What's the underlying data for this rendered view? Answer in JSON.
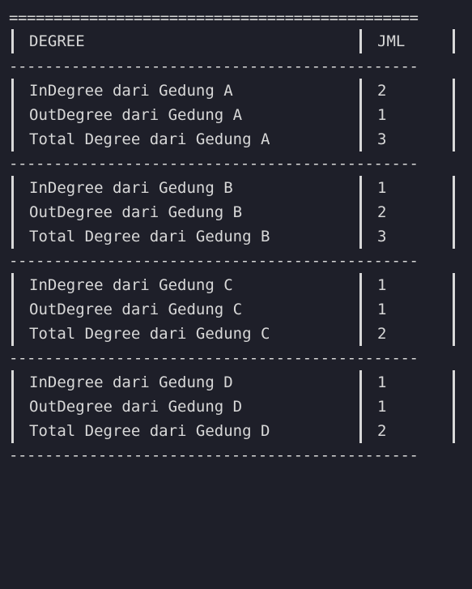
{
  "table": {
    "border_top": "==============================================",
    "separator": "----------------------------------------------",
    "header": {
      "degree": "DEGREE",
      "jml": "JML"
    },
    "groups": [
      {
        "rows": [
          {
            "label": "InDegree dari Gedung A",
            "value": "2"
          },
          {
            "label": "OutDegree dari Gedung A",
            "value": "1"
          },
          {
            "label": "Total Degree dari Gedung A",
            "value": "3"
          }
        ]
      },
      {
        "rows": [
          {
            "label": "InDegree dari Gedung B",
            "value": "1"
          },
          {
            "label": "OutDegree dari Gedung B",
            "value": "2"
          },
          {
            "label": "Total Degree dari Gedung B",
            "value": "3"
          }
        ]
      },
      {
        "rows": [
          {
            "label": "InDegree dari Gedung C",
            "value": "1"
          },
          {
            "label": "OutDegree dari Gedung C",
            "value": "1"
          },
          {
            "label": "Total Degree dari Gedung C",
            "value": "2"
          }
        ]
      },
      {
        "rows": [
          {
            "label": "InDegree dari Gedung D",
            "value": "1"
          },
          {
            "label": "OutDegree dari Gedung D",
            "value": "1"
          },
          {
            "label": "Total Degree dari Gedung D",
            "value": "2"
          }
        ]
      }
    ]
  }
}
